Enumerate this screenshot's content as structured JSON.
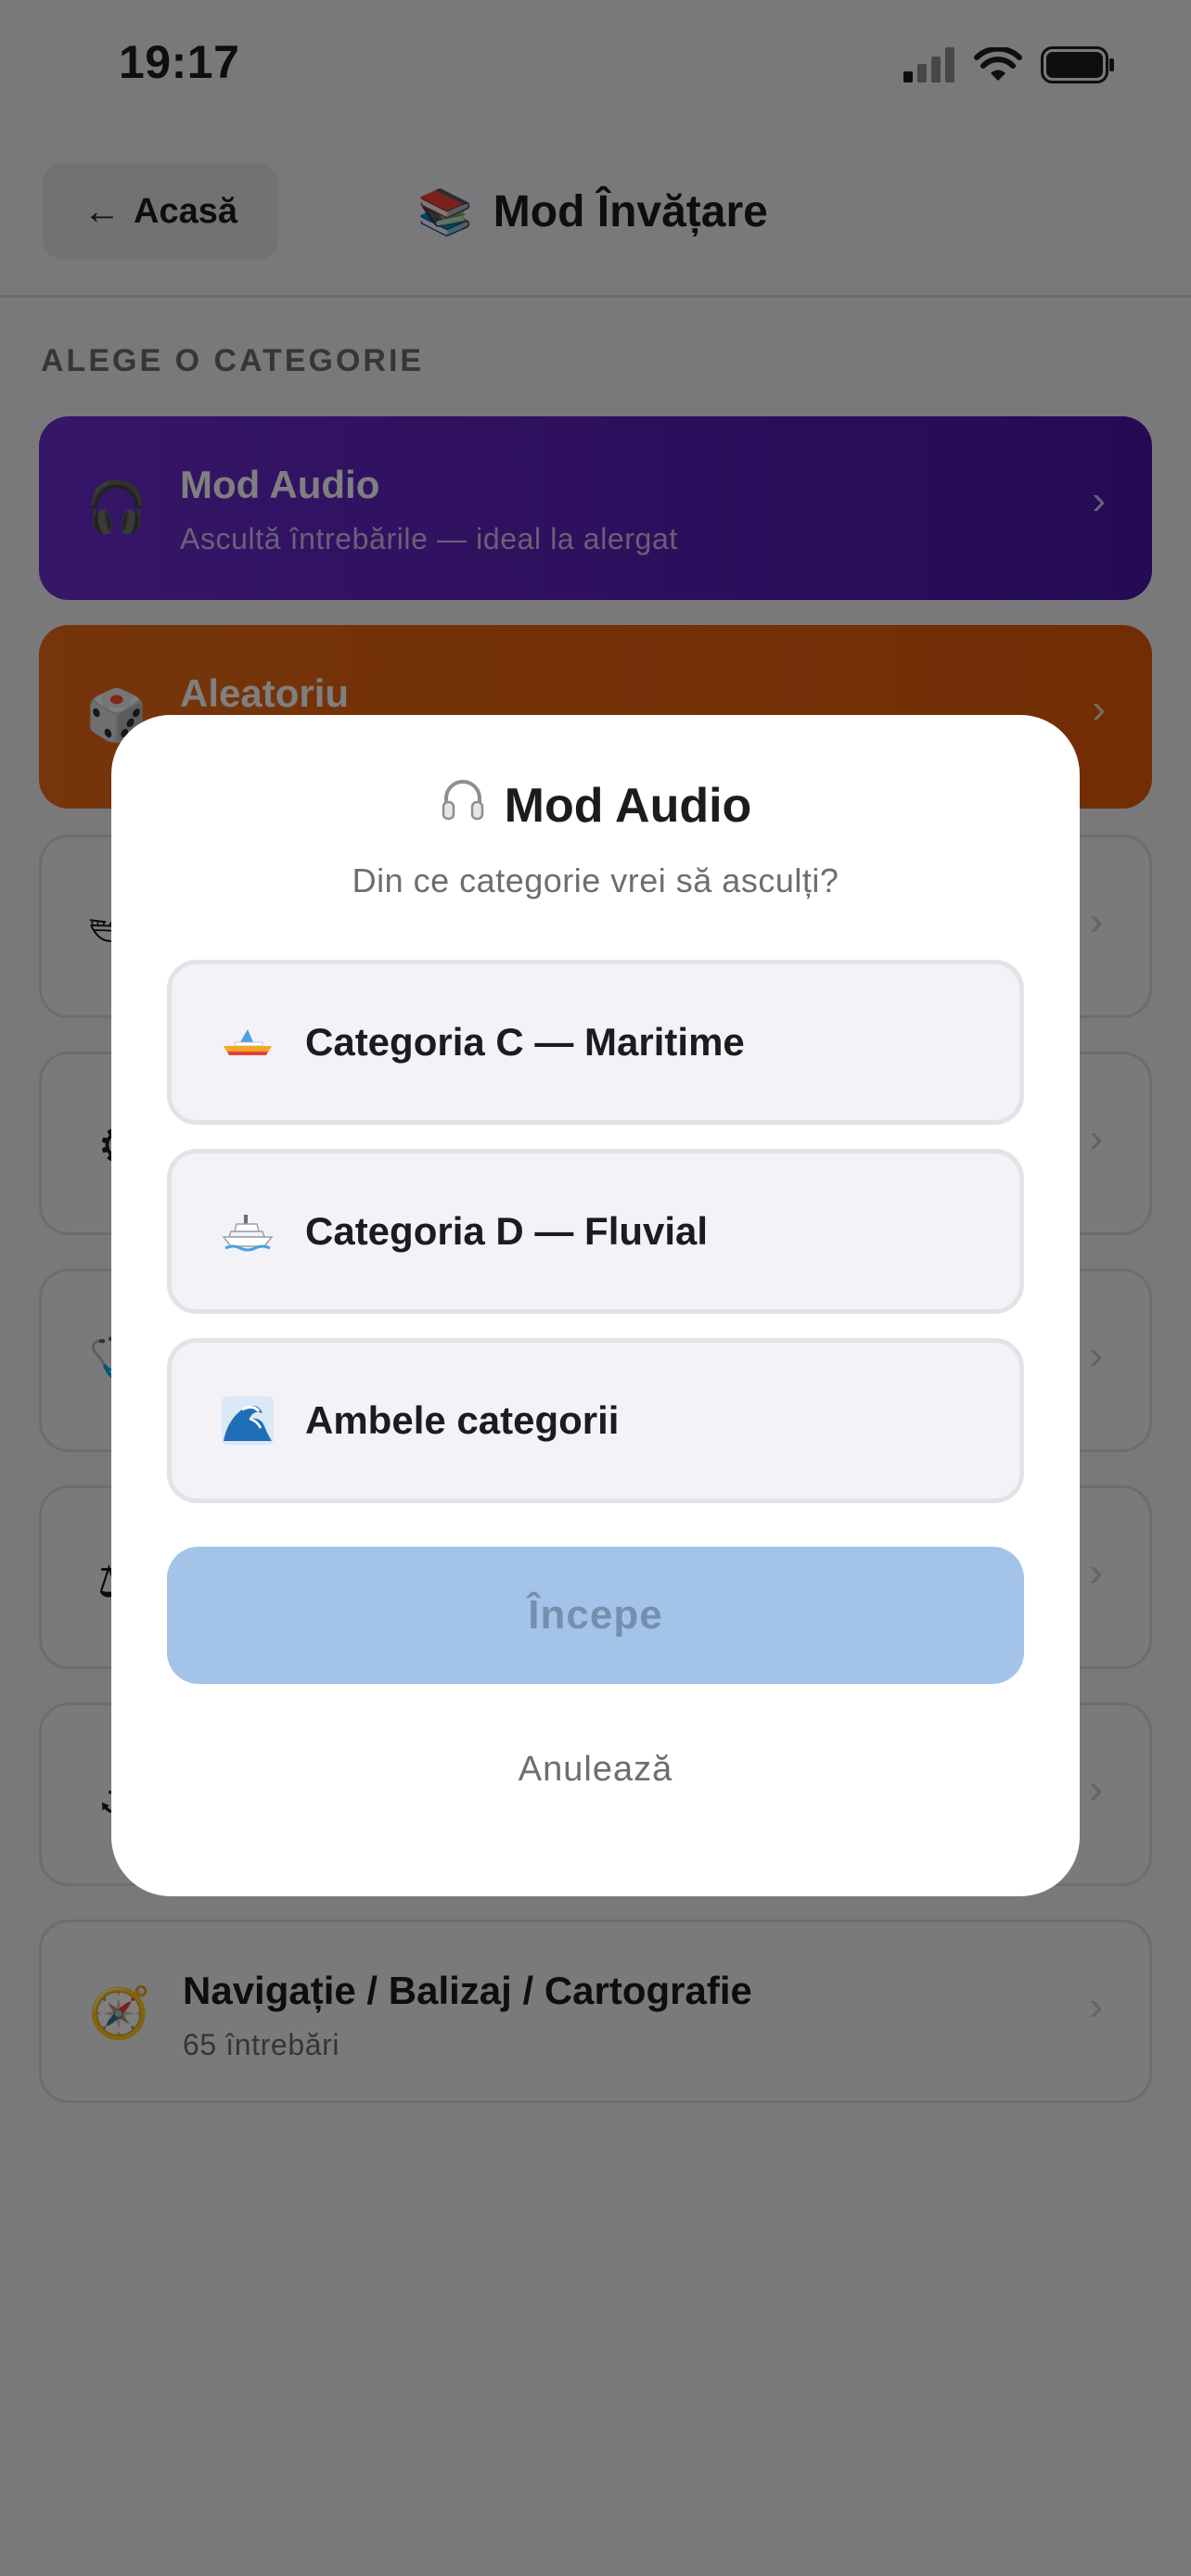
{
  "status_bar": {
    "time": "19:17",
    "icons": [
      "signal-icon",
      "wifi-icon",
      "battery-icon"
    ]
  },
  "header": {
    "back_label": "Acasă",
    "title_emoji": "📚",
    "title": "Mod Învățare"
  },
  "section_label": "ALEGE O CATEGORIE",
  "cards": [
    {
      "icon": "🎧",
      "title": "Mod Audio",
      "subtitle": "Ascultă întrebările — ideal la alergat",
      "style": "purple"
    },
    {
      "icon": "🎲",
      "title": "Aleatoriu",
      "subtitle": "",
      "style": "orange"
    },
    {
      "icon": "🛥",
      "title": "",
      "subtitle": "",
      "style": "plain"
    },
    {
      "icon": "⚙",
      "title": "",
      "subtitle": "",
      "style": "plain"
    },
    {
      "icon": "🩺",
      "title": "",
      "subtitle": "",
      "style": "plain"
    },
    {
      "icon": "⚖",
      "title": "",
      "subtitle": "",
      "style": "plain"
    },
    {
      "icon": "⚓",
      "title": "",
      "subtitle": "",
      "style": "plain"
    },
    {
      "icon": "🧭",
      "title": "Navigație / Balizaj / Cartografie",
      "subtitle": "65 întrebări",
      "style": "plain"
    }
  ],
  "modal": {
    "title_emoji": "🎧",
    "title": "Mod Audio",
    "subtitle": "Din ce categorie vrei să asculți?",
    "options": [
      {
        "icon": "boat-icon",
        "label": "Categoria C — Maritime"
      },
      {
        "icon": "ship-icon",
        "label": "Categoria D — Fluvial"
      },
      {
        "icon": "wave-icon",
        "label": "Ambele categorii"
      }
    ],
    "start_label": "Începe",
    "cancel_label": "Anulează"
  },
  "colors": {
    "purple_card": "#5a20bc",
    "orange_card": "#e8620f",
    "start_button": "#a3c4e8",
    "overlay": "rgba(0,0,0,0.5)"
  }
}
